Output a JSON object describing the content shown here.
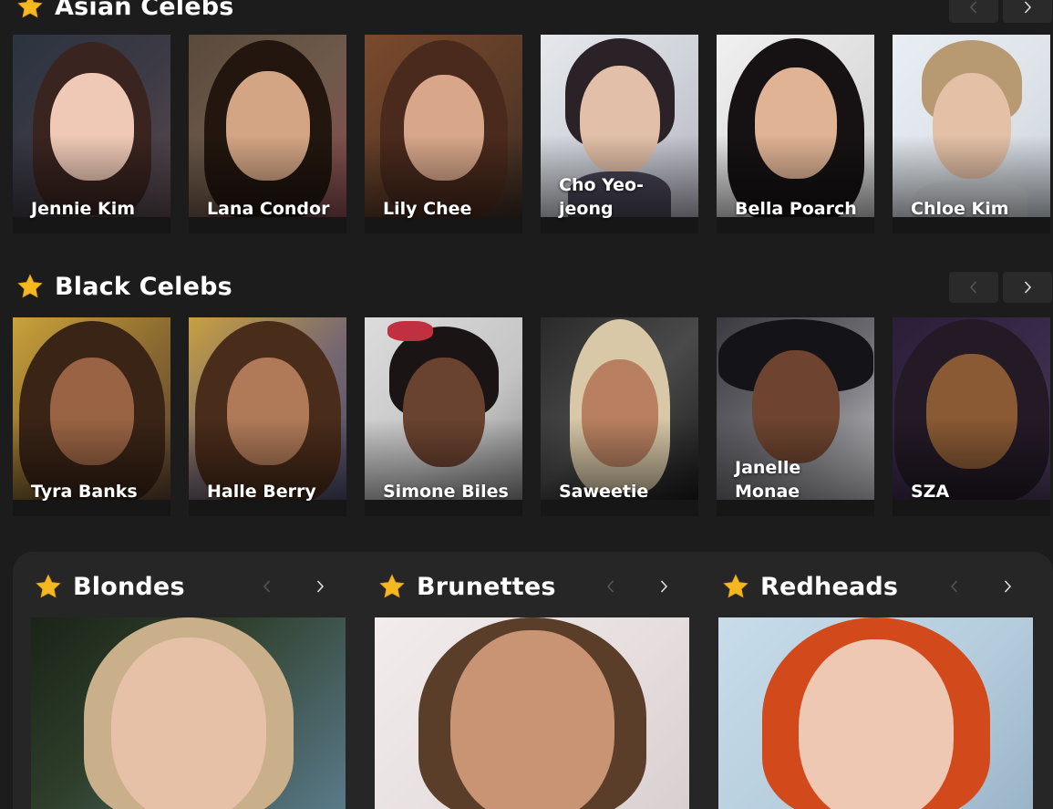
{
  "sections": [
    {
      "title": "Asian Celebs",
      "prev_icon": "chevron-left-icon",
      "next_icon": "chevron-right-icon",
      "cards": [
        {
          "name": "Jennie Kim"
        },
        {
          "name": "Lana Condor"
        },
        {
          "name": "Lily Chee"
        },
        {
          "name": "Cho Yeo-jeong"
        },
        {
          "name": "Bella Poarch"
        },
        {
          "name": "Chloe Kim"
        }
      ]
    },
    {
      "title": "Black Celebs",
      "prev_icon": "chevron-left-icon",
      "next_icon": "chevron-right-icon",
      "cards": [
        {
          "name": "Tyra Banks"
        },
        {
          "name": "Halle Berry"
        },
        {
          "name": "Simone Biles"
        },
        {
          "name": "Saweetie"
        },
        {
          "name": "Janelle Monae"
        },
        {
          "name": "SZA"
        }
      ]
    }
  ],
  "panel": {
    "columns": [
      {
        "title": "Blondes"
      },
      {
        "title": "Brunettes"
      },
      {
        "title": "Redheads"
      }
    ]
  },
  "colors": {
    "background": "#1c1c1c",
    "panel": "#262626",
    "star": "#f5b820",
    "nav_button": "#2a2a2a"
  }
}
